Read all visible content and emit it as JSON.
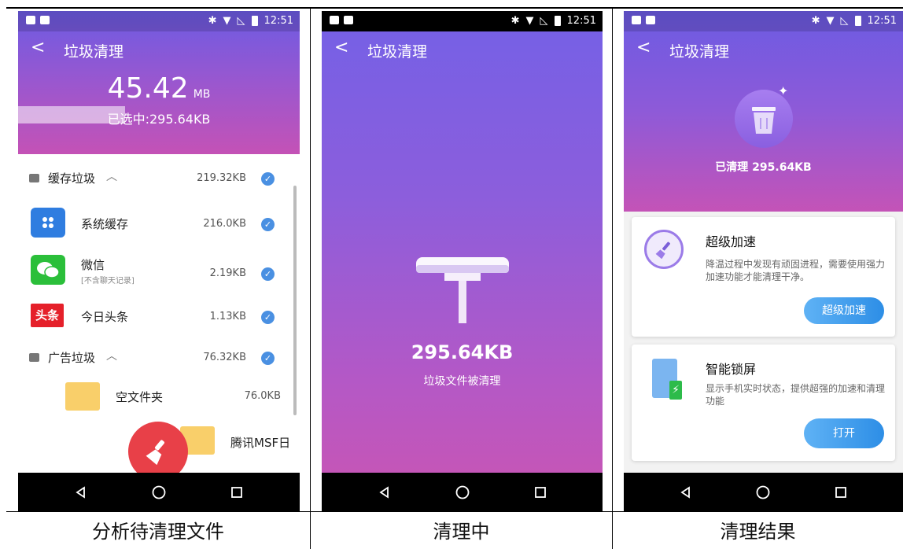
{
  "status": {
    "time": "12:51"
  },
  "screen1": {
    "title": "垃圾清理",
    "total_size": "45.42",
    "total_unit": "MB",
    "selected_text": "已选中:295.64KB",
    "progress": 0.38,
    "groups": [
      {
        "label": "缓存垃圾",
        "size": "219.32KB"
      },
      {
        "label": "广告垃圾",
        "size": "76.32KB"
      }
    ],
    "apps": [
      {
        "name": "系统缓存",
        "size": "216.0KB",
        "icon": "system-cache-icon"
      },
      {
        "name": "微信",
        "sub": "[不含聊天记录]",
        "size": "2.19KB",
        "icon": "wechat-icon"
      },
      {
        "name": "今日头条",
        "size": "1.13KB",
        "icon": "toutiao-icon",
        "icon_text": "头条"
      }
    ],
    "folders": [
      {
        "name": "空文件夹",
        "size": "76.0KB"
      },
      {
        "name": "腾讯MSF日"
      }
    ],
    "caption": "分析待清理文件"
  },
  "screen2": {
    "title": "垃圾清理",
    "amount": "295.64KB",
    "label": "垃圾文件被清理",
    "caption": "清理中"
  },
  "screen3": {
    "title": "垃圾清理",
    "done_text": "已清理 295.64KB",
    "cards": [
      {
        "title": "超级加速",
        "desc": "降温过程中发现有顽固进程，需要使用强力加速功能才能清理干净。",
        "button": "超级加速"
      },
      {
        "title": "智能锁屏",
        "desc": "显示手机实时状态，提供超强的加速和清理功能",
        "button": "打开"
      }
    ],
    "caption": "清理结果"
  },
  "colors": {
    "accent_blue": "#4a90e2",
    "gradient_top": "#6c5be3",
    "gradient_bottom": "#c452b6"
  }
}
